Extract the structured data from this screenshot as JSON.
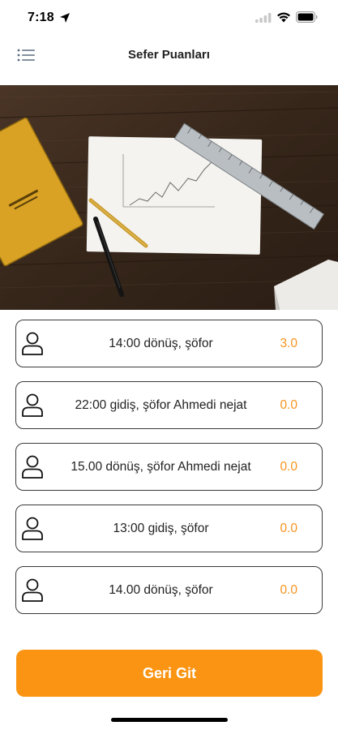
{
  "status_bar": {
    "time": "7:18"
  },
  "header": {
    "title": "Sefer Puanları",
    "menu_icon": "list-menu-icon"
  },
  "ratings": [
    {
      "label": "14:00 dönüş, şöfor",
      "score": "3.0"
    },
    {
      "label": "22:00 gidiş, şöfor Ahmedi nejat",
      "score": "0.0"
    },
    {
      "label": "15.00 dönüş, şöfor Ahmedi nejat",
      "score": "0.0"
    },
    {
      "label": "13:00 gidiş, şöfor",
      "score": "0.0"
    },
    {
      "label": "14.00 dönüş, şöfor",
      "score": "0.0"
    }
  ],
  "actions": {
    "back_label": "Geri Git"
  },
  "colors": {
    "accent": "#fb9412",
    "score": "#f7931e",
    "card_border": "#3a3a3a"
  }
}
